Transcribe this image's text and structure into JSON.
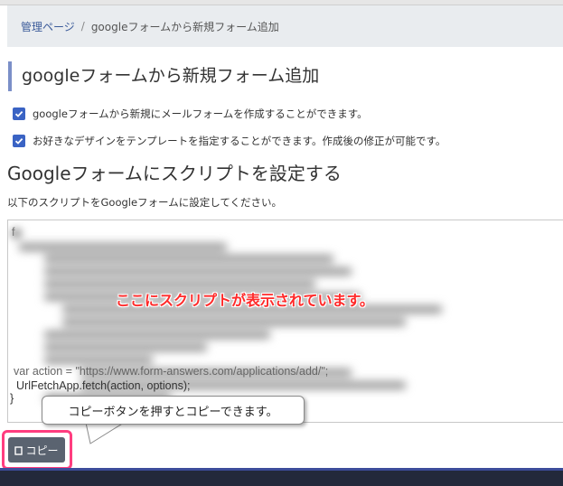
{
  "breadcrumb": {
    "home": "管理ページ",
    "separator": "/",
    "current": "googleフォームから新規フォーム追加"
  },
  "heading": "googleフォームから新規フォーム追加",
  "checks": [
    {
      "label": "googleフォームから新規にメールフォームを作成することができます。",
      "checked": true
    },
    {
      "label": "お好きなデザインをテンプレートを指定することができます。作成後の修正が可能です。",
      "checked": true
    }
  ],
  "subheading": "Googleフォームにスクリプトを設定する",
  "description": "以下のスクリプトをGoogleフォームに設定してください。",
  "script_box": {
    "visible_lines": [
      "var action = \"https://www.form-answers.com/applications/add/\";",
      "UrlFetchApp.fetch(action, options);",
      "}"
    ],
    "first_char": "f"
  },
  "overlay_note": "ここにスクリプトが表示されています。",
  "callout": "コピーボタンを押すとコピーできます。",
  "copy_button": {
    "label": "コピー",
    "icon": "copy-icon"
  },
  "colors": {
    "accent_bar": "#7b8fc8",
    "checkbox": "#3a63c4",
    "button": "#5a6370",
    "highlight": "#ff3d7f",
    "overlay_text": "#ff2a2a"
  }
}
